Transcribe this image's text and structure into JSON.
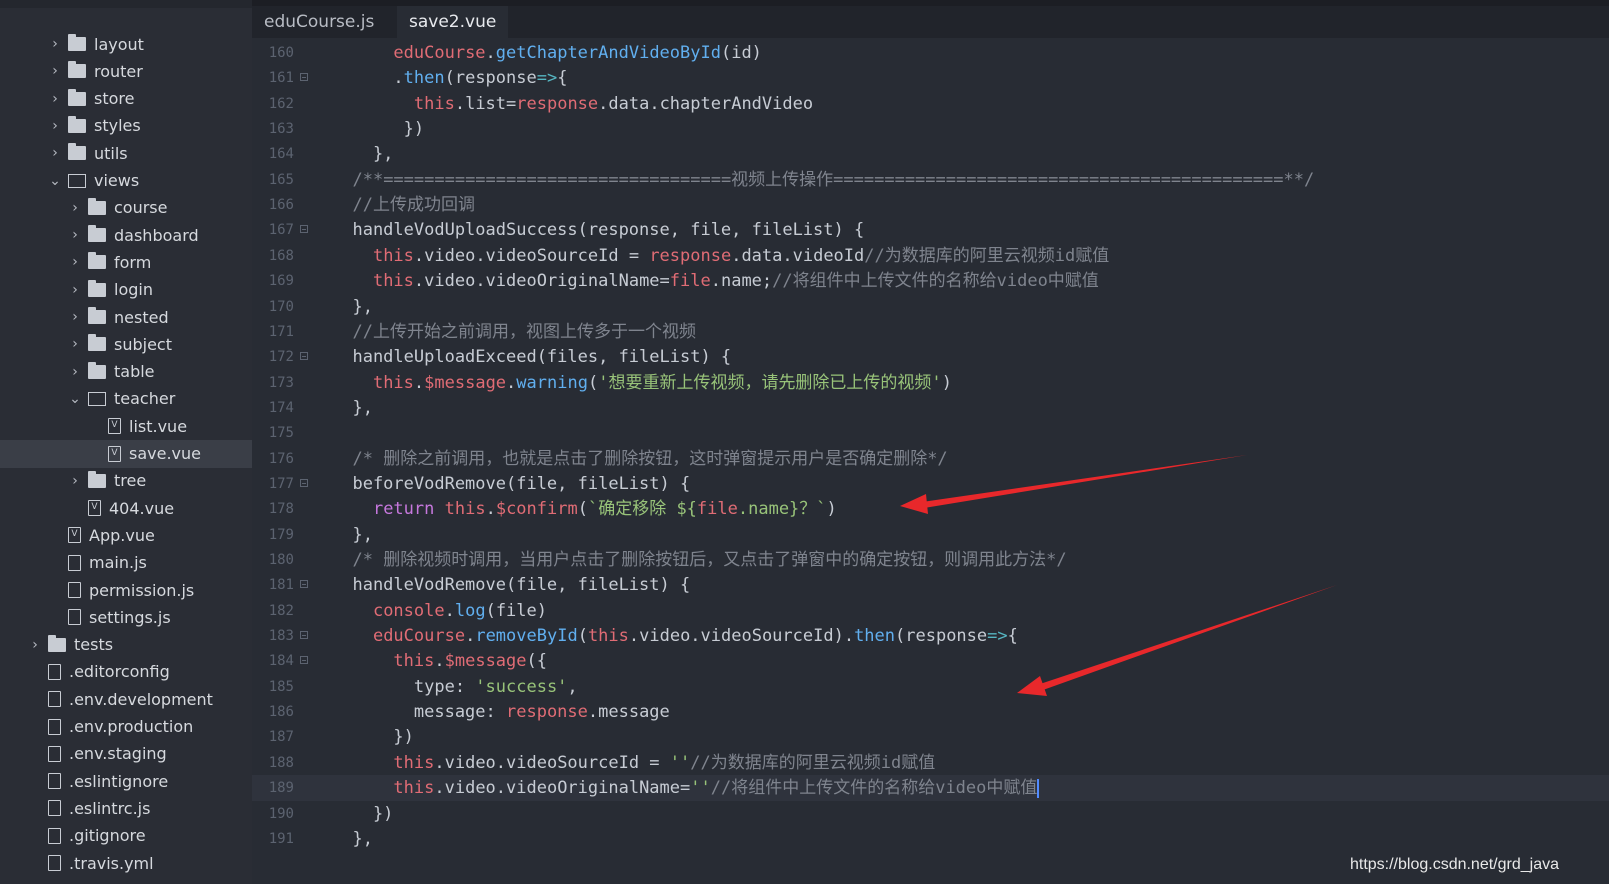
{
  "sidebar": {
    "items": [
      {
        "label": "layout",
        "kind": "folder",
        "depth": 1,
        "expanded": false
      },
      {
        "label": "router",
        "kind": "folder",
        "depth": 1,
        "expanded": false
      },
      {
        "label": "store",
        "kind": "folder",
        "depth": 1,
        "expanded": false
      },
      {
        "label": "styles",
        "kind": "folder",
        "depth": 1,
        "expanded": false
      },
      {
        "label": "utils",
        "kind": "folder",
        "depth": 1,
        "expanded": false
      },
      {
        "label": "views",
        "kind": "folder",
        "depth": 1,
        "expanded": true
      },
      {
        "label": "course",
        "kind": "folder",
        "depth": 2,
        "expanded": false
      },
      {
        "label": "dashboard",
        "kind": "folder",
        "depth": 2,
        "expanded": false
      },
      {
        "label": "form",
        "kind": "folder",
        "depth": 2,
        "expanded": false
      },
      {
        "label": "login",
        "kind": "folder",
        "depth": 2,
        "expanded": false
      },
      {
        "label": "nested",
        "kind": "folder",
        "depth": 2,
        "expanded": false
      },
      {
        "label": "subject",
        "kind": "folder",
        "depth": 2,
        "expanded": false
      },
      {
        "label": "table",
        "kind": "folder",
        "depth": 2,
        "expanded": false
      },
      {
        "label": "teacher",
        "kind": "folder",
        "depth": 2,
        "expanded": true
      },
      {
        "label": "list.vue",
        "kind": "vue",
        "depth": 3
      },
      {
        "label": "save.vue",
        "kind": "vue",
        "depth": 3,
        "selected": true
      },
      {
        "label": "tree",
        "kind": "folder",
        "depth": 2,
        "expanded": false
      },
      {
        "label": "404.vue",
        "kind": "vue",
        "depth": 2
      },
      {
        "label": "App.vue",
        "kind": "vue",
        "depth": 1
      },
      {
        "label": "main.js",
        "kind": "file",
        "depth": 1
      },
      {
        "label": "permission.js",
        "kind": "file",
        "depth": 1
      },
      {
        "label": "settings.js",
        "kind": "file",
        "depth": 1
      },
      {
        "label": "tests",
        "kind": "folder",
        "depth": 0,
        "expanded": false
      },
      {
        "label": ".editorconfig",
        "kind": "doc",
        "depth": 0
      },
      {
        "label": ".env.development",
        "kind": "doc",
        "depth": 0
      },
      {
        "label": ".env.production",
        "kind": "doc",
        "depth": 0
      },
      {
        "label": ".env.staging",
        "kind": "doc",
        "depth": 0
      },
      {
        "label": ".eslintignore",
        "kind": "doc",
        "depth": 0
      },
      {
        "label": ".eslintrc.js",
        "kind": "file",
        "depth": 0
      },
      {
        "label": ".gitignore",
        "kind": "doc",
        "depth": 0
      },
      {
        "label": ".travis.yml",
        "kind": "doc",
        "depth": 0
      }
    ]
  },
  "tabs": [
    {
      "label": "eduCourse.js",
      "active": false
    },
    {
      "label": "save2.vue",
      "active": true
    }
  ],
  "code": {
    "current_line": 189,
    "lines": [
      {
        "n": "160",
        "fold": false,
        "text": "      eduCourse.getChapterAndVideoById(id)"
      },
      {
        "n": "161",
        "fold": true,
        "text": "      .then(response=>{"
      },
      {
        "n": "162",
        "fold": false,
        "text": "        this.list=response.data.chapterAndVideo"
      },
      {
        "n": "163",
        "fold": false,
        "text": "       })"
      },
      {
        "n": "164",
        "fold": false,
        "text": "    },"
      },
      {
        "n": "165",
        "fold": false,
        "text": "  /**==================================视频上传操作============================================**/"
      },
      {
        "n": "166",
        "fold": false,
        "text": "  //上传成功回调"
      },
      {
        "n": "167",
        "fold": true,
        "text": "  handleVodUploadSuccess(response, file, fileList) {"
      },
      {
        "n": "168",
        "fold": false,
        "text": "    this.video.videoSourceId = response.data.videoId//为数据库的阿里云视频id赋值"
      },
      {
        "n": "169",
        "fold": false,
        "text": "    this.video.videoOriginalName=file.name;//将组件中上传文件的名称给video中赋值"
      },
      {
        "n": "170",
        "fold": false,
        "text": "  },"
      },
      {
        "n": "171",
        "fold": false,
        "text": "  //上传开始之前调用，视图上传多于一个视频"
      },
      {
        "n": "172",
        "fold": true,
        "text": "  handleUploadExceed(files, fileList) {"
      },
      {
        "n": "173",
        "fold": false,
        "text": "    this.$message.warning('想要重新上传视频，请先删除已上传的视频')"
      },
      {
        "n": "174",
        "fold": false,
        "text": "  },"
      },
      {
        "n": "175",
        "fold": false,
        "text": ""
      },
      {
        "n": "176",
        "fold": false,
        "text": "  /* 删除之前调用，也就是点击了删除按钮，这时弹窗提示用户是否确定删除*/"
      },
      {
        "n": "177",
        "fold": true,
        "text": "  beforeVodRemove(file, fileList) {"
      },
      {
        "n": "178",
        "fold": false,
        "text": "    return this.$confirm(`确定移除 ${file.name}？`)"
      },
      {
        "n": "179",
        "fold": false,
        "text": "  },"
      },
      {
        "n": "180",
        "fold": false,
        "text": "  /* 删除视频时调用，当用户点击了删除按钮后，又点击了弹窗中的确定按钮，则调用此方法*/"
      },
      {
        "n": "181",
        "fold": true,
        "text": "  handleVodRemove(file, fileList) {"
      },
      {
        "n": "182",
        "fold": false,
        "text": "    console.log(file)"
      },
      {
        "n": "183",
        "fold": true,
        "text": "    eduCourse.removeById(this.video.videoSourceId).then(response=>{"
      },
      {
        "n": "184",
        "fold": true,
        "text": "      this.$message({"
      },
      {
        "n": "185",
        "fold": false,
        "text": "        type: 'success',"
      },
      {
        "n": "186",
        "fold": false,
        "text": "        message: response.message"
      },
      {
        "n": "187",
        "fold": false,
        "text": "      })"
      },
      {
        "n": "188",
        "fold": false,
        "text": "      this.video.videoSourceId = ''//为数据库的阿里云视频id赋值"
      },
      {
        "n": "189",
        "fold": false,
        "text": "      this.video.videoOriginalName=''//将组件中上传文件的名称给video中赋值"
      },
      {
        "n": "190",
        "fold": false,
        "text": "    })"
      },
      {
        "n": "191",
        "fold": false,
        "text": "  },"
      }
    ]
  },
  "watermark": "https://blog.csdn.net/grd_java",
  "colors": {
    "arrow": "#e8282b",
    "background": "#282c34",
    "sidebar": "#2a2d35"
  }
}
